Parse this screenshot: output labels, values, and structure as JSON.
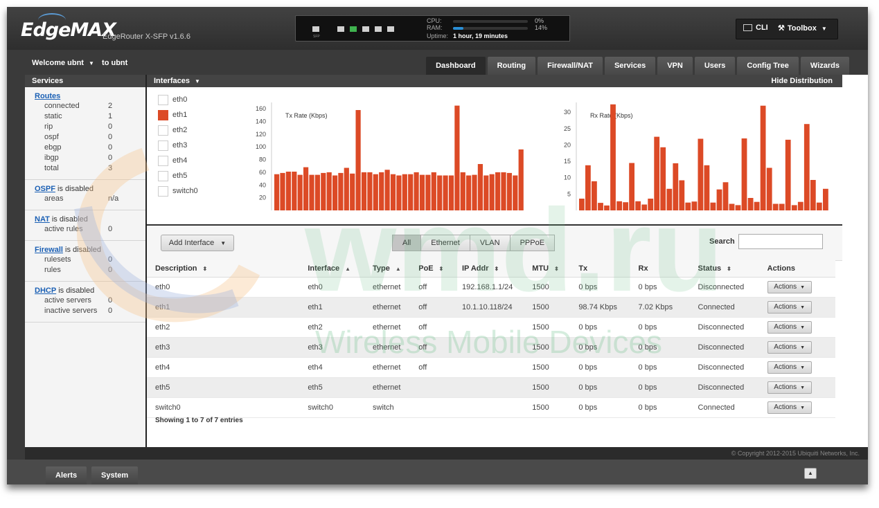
{
  "header": {
    "logo": "EdgeMAX",
    "model": "EdgeRouter X-SFP v1.6.6",
    "port_label": "SFP",
    "cpu_label": "CPU:",
    "ram_label": "RAM:",
    "uptime_label": "Uptime:",
    "cpu_pct": "0%",
    "ram_pct": "14%",
    "cpu_fraction": 0.0,
    "ram_fraction": 0.14,
    "uptime": "1 hour, 19 minutes",
    "cli": "CLI",
    "toolbox": "Toolbox"
  },
  "nav": {
    "welcome": "Welcome ubnt",
    "to_user": "to ubnt",
    "tabs": [
      "Dashboard",
      "Routing",
      "Firewall/NAT",
      "Services",
      "VPN",
      "Users",
      "Config Tree",
      "Wizards"
    ],
    "active_tab": "Dashboard"
  },
  "sidebar": {
    "title": "Services",
    "routes": {
      "link": "Routes",
      "rows": [
        {
          "k": "connected",
          "v": "2"
        },
        {
          "k": "static",
          "v": "1"
        },
        {
          "k": "rip",
          "v": "0"
        },
        {
          "k": "ospf",
          "v": "0"
        },
        {
          "k": "ebgp",
          "v": "0"
        },
        {
          "k": "ibgp",
          "v": "0"
        },
        {
          "k": "total",
          "v": "3"
        }
      ]
    },
    "ospf": {
      "link": "OSPF",
      "status": " is disabled",
      "rows": [
        {
          "k": "areas",
          "v": "n/a"
        }
      ]
    },
    "nat": {
      "link": "NAT",
      "status": " is disabled",
      "rows": [
        {
          "k": "active rules",
          "v": "0"
        }
      ]
    },
    "firewall": {
      "link": "Firewall",
      "status": " is disabled",
      "rows": [
        {
          "k": "rulesets",
          "v": "0"
        },
        {
          "k": "rules",
          "v": "0"
        }
      ]
    },
    "dhcp": {
      "link": "DHCP",
      "status": " is disabled",
      "rows": [
        {
          "k": "active servers",
          "v": "0"
        },
        {
          "k": "inactive servers",
          "v": "0"
        }
      ]
    }
  },
  "interfaces_panel": {
    "title": "Interfaces",
    "hide": "Hide Distribution",
    "legend": [
      "eth0",
      "eth1",
      "eth2",
      "eth3",
      "eth4",
      "eth5",
      "switch0"
    ],
    "legend_selected": "eth1"
  },
  "chart_data": [
    {
      "type": "bar",
      "title": "Tx Rate (Kbps)",
      "series": [
        {
          "name": "eth1",
          "values": [
            57,
            59,
            61,
            61,
            56,
            68,
            56,
            56,
            59,
            60,
            55,
            59,
            67,
            58,
            158,
            60,
            60,
            57,
            60,
            64,
            57,
            55,
            57,
            57,
            60,
            56,
            56,
            60,
            55,
            55,
            55,
            165,
            60,
            55,
            56,
            73,
            55,
            57,
            60,
            60,
            59,
            55,
            96
          ]
        }
      ],
      "ylim": [
        0,
        170
      ],
      "yticks": [
        20,
        40,
        60,
        80,
        100,
        120,
        140,
        160
      ],
      "color": "#dc4a26"
    },
    {
      "type": "bar",
      "title": "Rx Rate (Kbps)",
      "series": [
        {
          "name": "eth1",
          "values": [
            3.6,
            13.8,
            8.9,
            2.3,
            1.5,
            32.4,
            2.8,
            2.5,
            14.5,
            2.8,
            1.8,
            3.6,
            22.5,
            19.3,
            6.6,
            14.4,
            9.2,
            2.4,
            2.7,
            21.9,
            13.8,
            2.4,
            6.4,
            8.6,
            2.0,
            1.6,
            22.0,
            3.8,
            2.6,
            32.0,
            13.0,
            2.0,
            2.0,
            21.6,
            1.6,
            2.6,
            26.4,
            9.3,
            2.4,
            6.6
          ]
        }
      ],
      "ylim": [
        0,
        33
      ],
      "yticks": [
        5,
        10,
        15,
        20,
        25,
        30
      ],
      "color": "#dc4a26"
    }
  ],
  "toolbar": {
    "add_interface": "Add Interface",
    "filters": [
      "All",
      "Ethernet",
      "VLAN",
      "PPPoE"
    ],
    "active_filter": "All",
    "search_label": "Search",
    "search_value": ""
  },
  "table": {
    "columns": [
      "Description",
      "Interface",
      "Type",
      "PoE",
      "IP Addr",
      "MTU",
      "Tx",
      "Rx",
      "Status",
      "Actions"
    ],
    "rows": [
      {
        "description": "eth0",
        "interface": "eth0",
        "type": "ethernet",
        "poe": "off",
        "ip": "192.168.1.1/24",
        "mtu": "1500",
        "tx": "0 bps",
        "rx": "0 bps",
        "status": "Disconnected",
        "actions": "Actions"
      },
      {
        "description": "eth1",
        "interface": "eth1",
        "type": "ethernet",
        "poe": "off",
        "ip": "10.1.10.118/24",
        "mtu": "1500",
        "tx": "98.74 Kbps",
        "rx": "7.02 Kbps",
        "status": "Connected",
        "actions": "Actions"
      },
      {
        "description": "eth2",
        "interface": "eth2",
        "type": "ethernet",
        "poe": "off",
        "ip": "",
        "mtu": "1500",
        "tx": "0 bps",
        "rx": "0 bps",
        "status": "Disconnected",
        "actions": "Actions"
      },
      {
        "description": "eth3",
        "interface": "eth3",
        "type": "ethernet",
        "poe": "off",
        "ip": "",
        "mtu": "1500",
        "tx": "0 bps",
        "rx": "0 bps",
        "status": "Disconnected",
        "actions": "Actions"
      },
      {
        "description": "eth4",
        "interface": "eth4",
        "type": "ethernet",
        "poe": "off",
        "ip": "",
        "mtu": "1500",
        "tx": "0 bps",
        "rx": "0 bps",
        "status": "Disconnected",
        "actions": "Actions"
      },
      {
        "description": "eth5",
        "interface": "eth5",
        "type": "ethernet",
        "poe": "",
        "ip": "",
        "mtu": "1500",
        "tx": "0 bps",
        "rx": "0 bps",
        "status": "Disconnected",
        "actions": "Actions"
      },
      {
        "description": "switch0",
        "interface": "switch0",
        "type": "switch",
        "poe": "",
        "ip": "",
        "mtu": "1500",
        "tx": "0 bps",
        "rx": "0 bps",
        "status": "Connected",
        "actions": "Actions"
      }
    ],
    "footer": "Showing 1 to 7 of 7 entries"
  },
  "footer": {
    "copyright": "© Copyright 2012-2015 Ubiquiti Networks, Inc.",
    "tabs": [
      "Alerts",
      "System"
    ]
  },
  "watermark": {
    "text": "Wireless Mobile Devices",
    "logo": "wmd.ru"
  },
  "colors": {
    "accent": "#dc4a26",
    "connected": "#2e8b2e",
    "disconnected": "#e0603a",
    "link": "#1a5fb4"
  }
}
